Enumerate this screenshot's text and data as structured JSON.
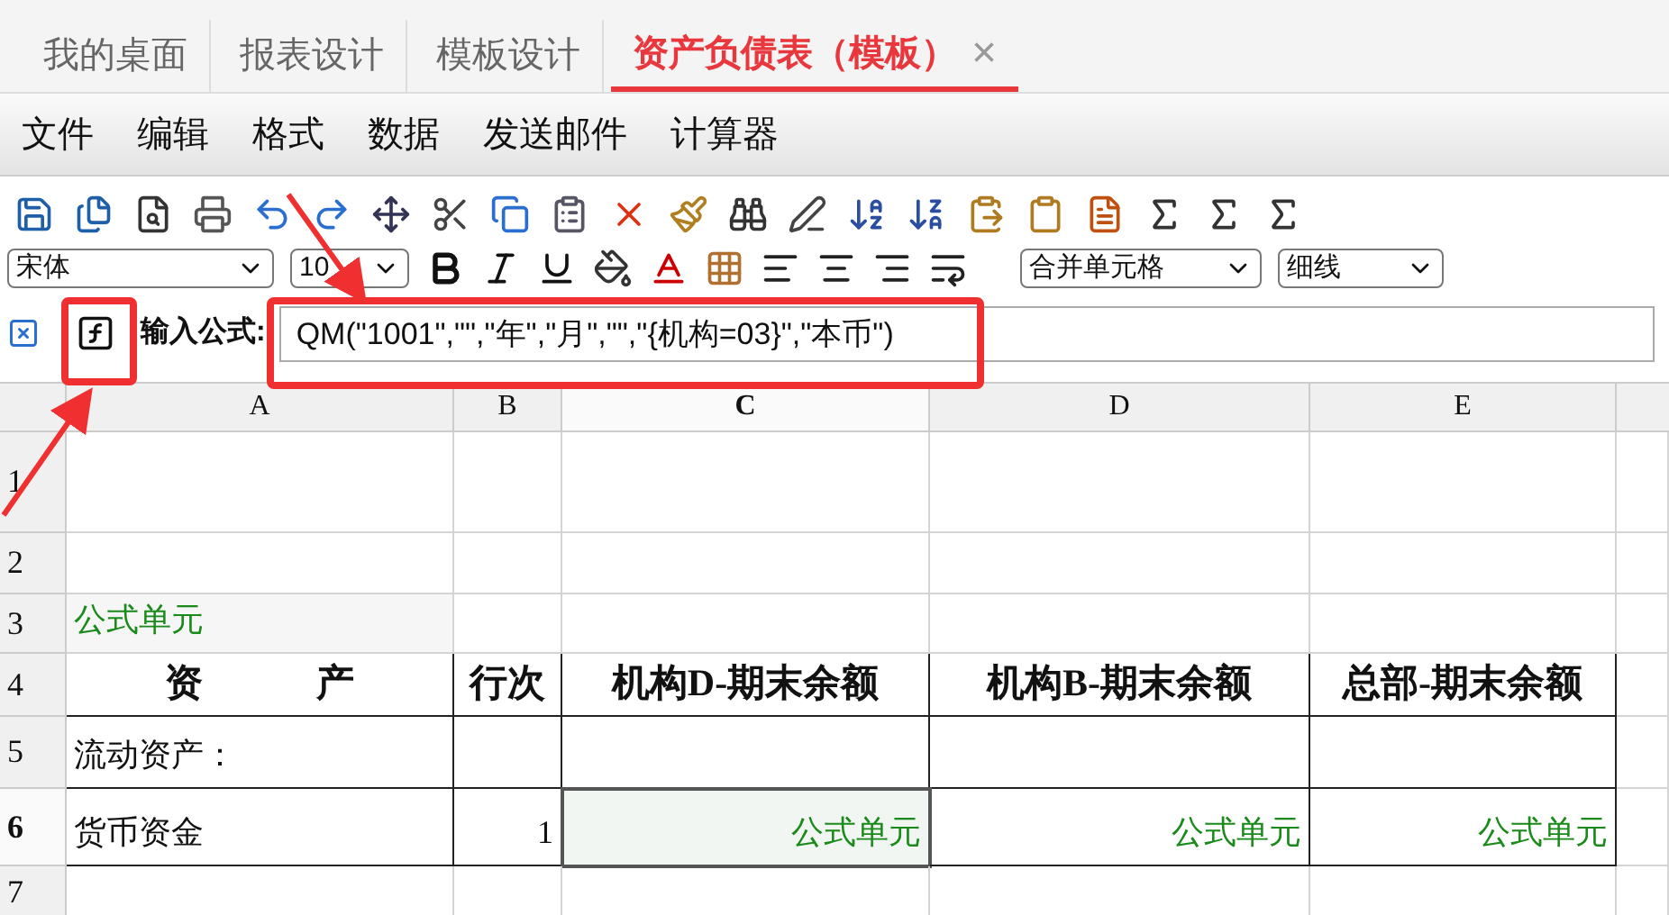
{
  "tabs": [
    {
      "label": "我的桌面",
      "selected": false
    },
    {
      "label": "报表设计",
      "selected": false
    },
    {
      "label": "模板设计",
      "selected": false
    },
    {
      "label": "资产负债表（模板）",
      "selected": true,
      "close": "×"
    }
  ],
  "menu": [
    "文件",
    "编辑",
    "格式",
    "数据",
    "发送邮件",
    "计算器"
  ],
  "format_bar": {
    "font": "宋体",
    "size": "10",
    "merge": "合并单元格",
    "border": "细线"
  },
  "formula_bar": {
    "label": "输入公式:",
    "value": "QM(\"1001\",\"\",\"年\",\"月\",\"\",\"{机构=03}\",\"本币\")"
  },
  "sheet": {
    "columns": [
      {
        "label": "A",
        "selected": false
      },
      {
        "label": "B",
        "selected": false
      },
      {
        "label": "C",
        "selected": true
      },
      {
        "label": "D",
        "selected": false
      },
      {
        "label": "E",
        "selected": false
      }
    ],
    "rows": [
      {
        "number": "1",
        "selected": false,
        "cells": [
          {
            "kind": "empty"
          },
          {
            "kind": "empty"
          },
          {
            "kind": "empty"
          },
          {
            "kind": "empty"
          },
          {
            "kind": "empty"
          }
        ]
      },
      {
        "number": "2",
        "selected": false,
        "cells": [
          {
            "kind": "empty"
          },
          {
            "kind": "empty"
          },
          {
            "kind": "empty"
          },
          {
            "kind": "empty"
          },
          {
            "kind": "empty"
          }
        ]
      },
      {
        "number": "3",
        "selected": false,
        "cells": [
          {
            "kind": "formula",
            "text": "公式单元"
          },
          {
            "kind": "empty"
          },
          {
            "kind": "empty"
          },
          {
            "kind": "empty"
          },
          {
            "kind": "empty"
          }
        ]
      },
      {
        "number": "4",
        "selected": false,
        "cells": [
          {
            "kind": "header",
            "text": "资　　　产"
          },
          {
            "kind": "header",
            "text": "行次"
          },
          {
            "kind": "header",
            "text": "机构D-期末余额"
          },
          {
            "kind": "header",
            "text": "机构B-期末余额"
          },
          {
            "kind": "header",
            "text": "总部-期末余额"
          }
        ]
      },
      {
        "number": "5",
        "selected": false,
        "cells": [
          {
            "kind": "text",
            "text": "流动资产："
          },
          {
            "kind": "empty"
          },
          {
            "kind": "empty"
          },
          {
            "kind": "empty"
          },
          {
            "kind": "empty"
          }
        ]
      },
      {
        "number": "6",
        "selected": true,
        "cells": [
          {
            "kind": "text",
            "text": "货币资金"
          },
          {
            "kind": "number",
            "text": "1"
          },
          {
            "kind": "formula",
            "text": "公式单元",
            "selected": true
          },
          {
            "kind": "formula",
            "text": "公式单元",
            "selected": false
          },
          {
            "kind": "formula",
            "text": "公式单元",
            "selected": false
          }
        ]
      },
      {
        "number": "7",
        "selected": false,
        "cells": [
          {
            "kind": "empty"
          },
          {
            "kind": "empty"
          },
          {
            "kind": "empty"
          },
          {
            "kind": "empty"
          },
          {
            "kind": "empty"
          }
        ]
      }
    ]
  }
}
